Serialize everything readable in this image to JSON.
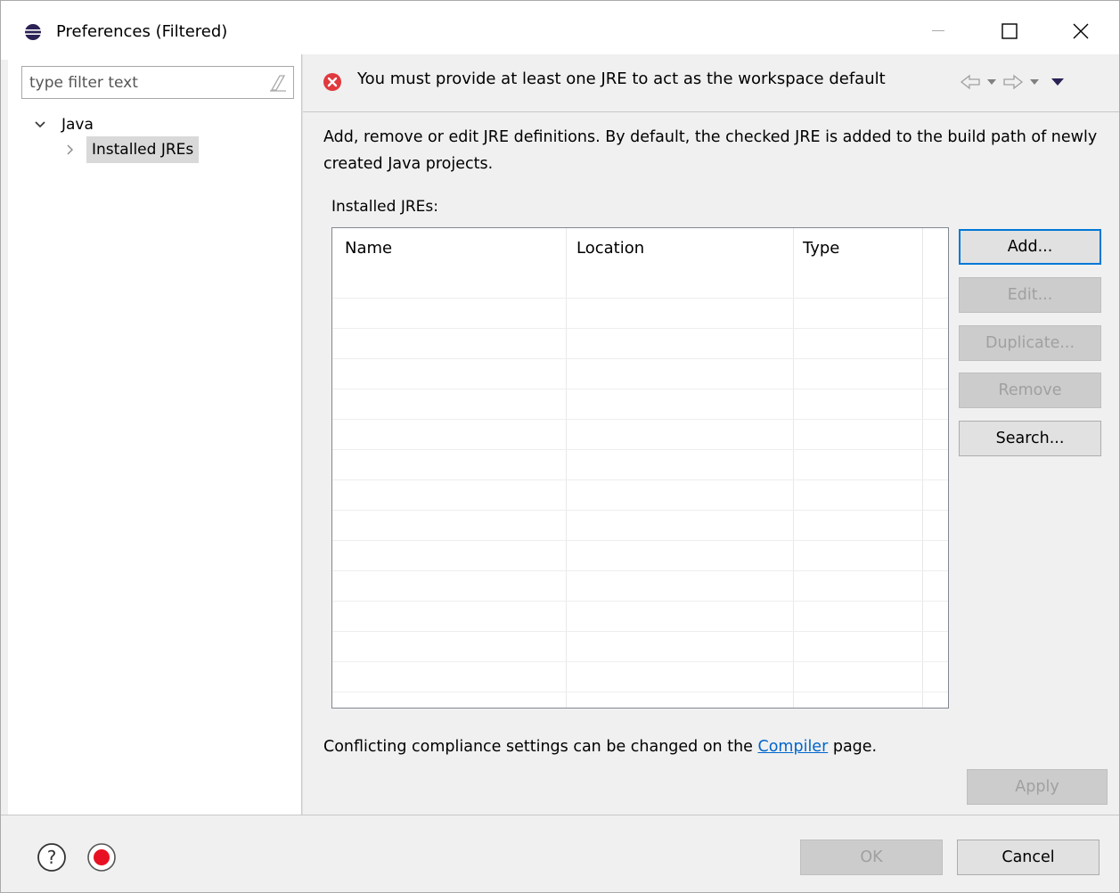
{
  "window": {
    "title": "Preferences (Filtered)"
  },
  "filter": {
    "placeholder": "type filter text"
  },
  "tree": {
    "root_label": "Java",
    "child_label": "Installed JREs"
  },
  "message": {
    "text": "You must provide at least one JRE to act as the workspace default"
  },
  "page": {
    "description": "Add, remove or edit JRE definitions. By default, the checked JRE is added to the build path of newly created Java projects.",
    "table_label": "Installed JREs:",
    "columns": [
      "Name",
      "Location",
      "Type"
    ],
    "footer_prefix": "Conflicting compliance settings can be changed on the ",
    "footer_link": "Compiler",
    "footer_suffix": " page."
  },
  "buttons": {
    "add": "Add...",
    "edit": "Edit...",
    "duplicate": "Duplicate...",
    "remove": "Remove",
    "search": "Search...",
    "apply": "Apply",
    "ok": "OK",
    "cancel": "Cancel"
  },
  "colors": {
    "error": "#e0393e",
    "link": "#0066cc",
    "default_button_border": "#0078d7",
    "record": "#e81123"
  }
}
